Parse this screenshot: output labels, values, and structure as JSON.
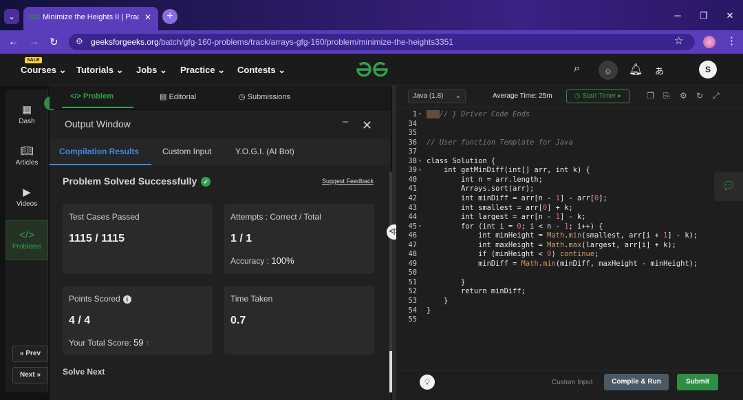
{
  "browser": {
    "tab_title": "Minimize the Heights II | Practic",
    "url_host": "geeksforgeeks.org",
    "url_path": "/batch/gfg-160-problems/track/arrays-gfg-160/problem/minimize-the-heights3351"
  },
  "site_nav": {
    "sale_badge": "SALE",
    "items": [
      {
        "label": "Courses"
      },
      {
        "label": "Tutorials"
      },
      {
        "label": "Jobs"
      },
      {
        "label": "Practice"
      },
      {
        "label": "Contests"
      }
    ],
    "avatar_letter": "S"
  },
  "rail": {
    "items": [
      {
        "label": "Dash"
      },
      {
        "label": "Articles"
      },
      {
        "label": "Videos"
      },
      {
        "label": "Problems"
      }
    ],
    "prev_label": "« Prev",
    "next_label": "Next »"
  },
  "problem_tabs": {
    "problem": "Problem",
    "editorial": "Editorial",
    "submissions": "Submissions"
  },
  "output_window": {
    "title": "Output Window",
    "tabs": [
      "Compilation Results",
      "Custom Input",
      "Y.O.G.I. (AI Bot)"
    ],
    "status": "Problem Solved Successfully",
    "feedback": "Suggest Feedback",
    "cards": {
      "test_cases": {
        "label": "Test Cases Passed",
        "value": "1115 / 1115"
      },
      "attempts": {
        "label": "Attempts : Correct / Total",
        "value": "1 / 1",
        "sub_label": "Accuracy :",
        "sub_value": "100%"
      },
      "points": {
        "label": "Points Scored",
        "value": "4 / 4",
        "sub_label": "Your Total Score:",
        "sub_value": "59"
      },
      "time": {
        "label": "Time Taken",
        "value": "0.7"
      }
    },
    "solve_next": "Solve Next"
  },
  "editor": {
    "language": "Java (1.8)",
    "avg_time": "Average Time: 25m",
    "start_timer": "Start Timer",
    "custom_input": "Custom Input",
    "compile_run": "Compile & Run",
    "submit": "Submit",
    "line_numbers": [
      "1",
      "34",
      "35",
      "36",
      "37",
      "38",
      "39",
      "40",
      "41",
      "42",
      "43",
      "44",
      "45",
      "46",
      "47",
      "48",
      "49",
      "50",
      "51",
      "52",
      "53",
      "54",
      "55"
    ],
    "code_lines": [
      "// } Driver Code Ends",
      "",
      "",
      "// User function Template for Java",
      "",
      "class Solution {",
      "    int getMinDiff(int[] arr, int k) {",
      "        int n = arr.length;",
      "        Arrays.sort(arr);",
      "        int minDiff = arr[n - 1] - arr[0];",
      "        int smallest = arr[0] + k;",
      "        int largest = arr[n - 1] - k;",
      "        for (int i = 0; i < n - 1; i++) {",
      "            int minHeight = Math.min(smallest, arr[i + 1] - k);",
      "            int maxHeight = Math.max(largest, arr[i] + k);",
      "            if (minHeight < 0) continue;",
      "            minDiff = Math.min(minDiff, maxHeight - minHeight);",
      "",
      "        }",
      "        return minDiff;",
      "    }",
      "}",
      ""
    ]
  },
  "colors": {
    "accent_green": "#2fa14f",
    "accent_blue": "#3b8be0",
    "browser_purple": "#5a3dba"
  }
}
